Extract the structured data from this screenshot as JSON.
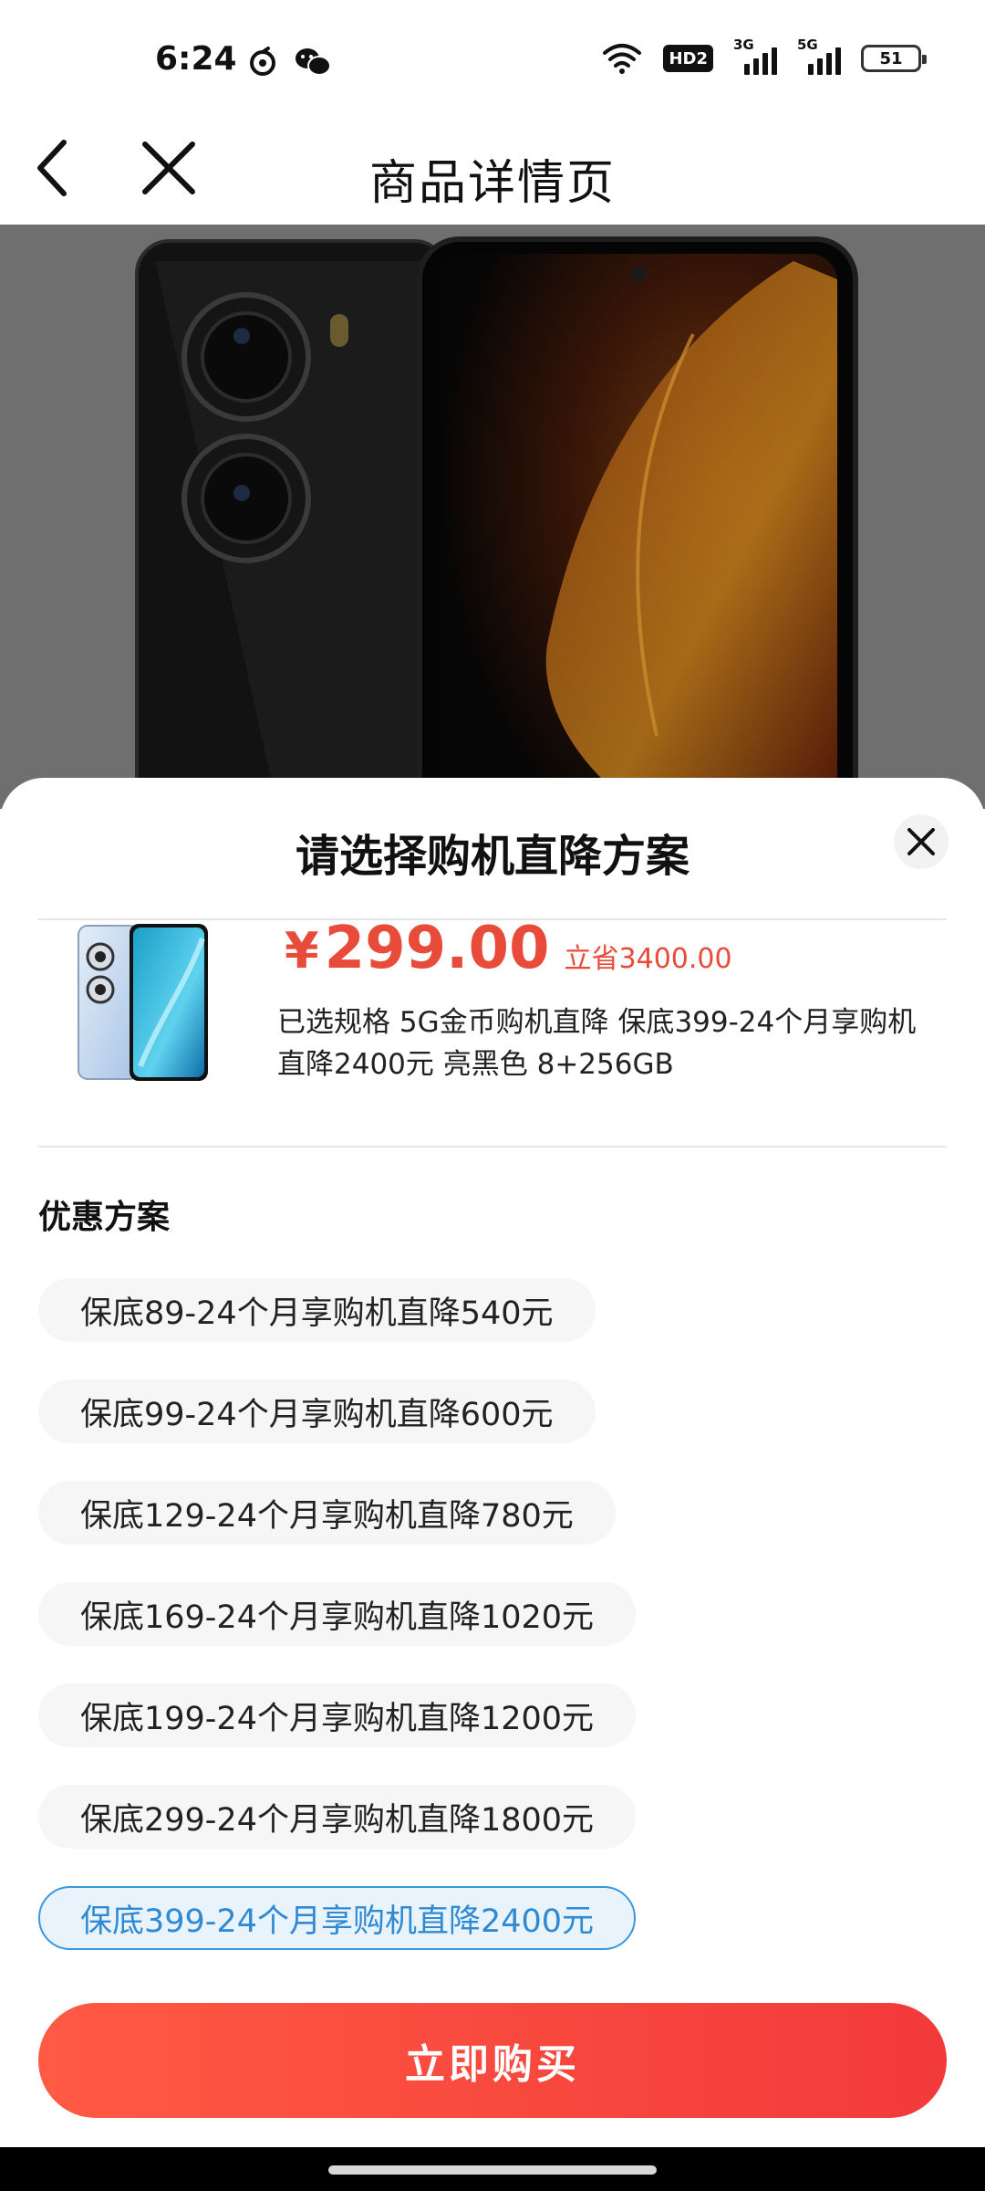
{
  "status_bar": {
    "time": "6:24",
    "app_icons": [
      "netease-icon",
      "wechat-icon"
    ],
    "hd_label": "HD2",
    "signal_1_label": "3G",
    "signal_2_label": "5G",
    "battery": "51"
  },
  "navbar": {
    "title": "商品详情页",
    "back_icon": "chevron-left-icon",
    "close_icon": "close-icon"
  },
  "sheet": {
    "title": "请选择购机直降方案",
    "product": {
      "currency": "¥",
      "price": "299.00",
      "save": "立省3400.00",
      "spec": "已选规格 5G金币购机直降 保底399-24个月享购机直降2400元 亮黑色 8+256GB"
    },
    "section_title": "优惠方案",
    "options": [
      {
        "label": "保底89-24个月享购机直降540元",
        "selected": false
      },
      {
        "label": "保底99-24个月享购机直降600元",
        "selected": false
      },
      {
        "label": "保底129-24个月享购机直降780元",
        "selected": false
      },
      {
        "label": "保底169-24个月享购机直降1020元",
        "selected": false
      },
      {
        "label": "保底199-24个月享购机直降1200元",
        "selected": false
      },
      {
        "label": "保底299-24个月享购机直降1800元",
        "selected": false
      },
      {
        "label": "保底399-24个月享购机直降2400元",
        "selected": true
      }
    ],
    "buy_button": "立即购买"
  },
  "colors": {
    "price_red": "#e84b3a",
    "selected_blue": "#3a96dd",
    "buy_gradient_start": "#ff5a44",
    "buy_gradient_end": "#f23a3a"
  }
}
